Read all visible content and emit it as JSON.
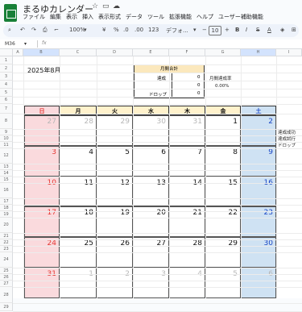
{
  "doc": {
    "title": "まるゆカレンダー"
  },
  "menu": [
    "ファイル",
    "編集",
    "表示",
    "挿入",
    "表示形式",
    "データ",
    "ツール",
    "拡張機能",
    "ヘルプ",
    "ユーザー補助機能"
  ],
  "toolbar": {
    "zoom": "100%",
    "currency": "¥",
    "percent": "%",
    "decimal_dec": ".0",
    "decimal_inc": ".00",
    "format_123": "123",
    "font": "デフォ...",
    "font_size": "10"
  },
  "cell_ref": "M36",
  "columns": [
    "A",
    "B",
    "C",
    "D",
    "E",
    "F",
    "G",
    "H",
    "I"
  ],
  "rows": [
    "1",
    "2",
    "3",
    "4",
    "5",
    "6",
    "7",
    "8",
    "9",
    "10",
    "11",
    "12",
    "13",
    "14",
    "15",
    "16",
    "17",
    "18",
    "19",
    "20",
    "21",
    "22",
    "23",
    "24",
    "25",
    "26",
    "27",
    "28",
    "29"
  ],
  "sheet": {
    "month_title": "2025年8月",
    "summary": {
      "header": "月間合計",
      "row1_label": "達成",
      "row1_value": "0",
      "row2_value": "0",
      "row3_label": "ドロップ",
      "row3_value": "0"
    },
    "rate_label": "月間達成率",
    "rate_value": "0.00%",
    "weekdays": [
      "日",
      "月",
      "火",
      "水",
      "木",
      "金",
      "土"
    ],
    "weeks": [
      [
        "27",
        "28",
        "29",
        "30",
        "31",
        "1",
        "2"
      ],
      [
        "3",
        "4",
        "5",
        "6",
        "7",
        "8",
        "9"
      ],
      [
        "10",
        "11",
        "12",
        "13",
        "14",
        "15",
        "16"
      ],
      [
        "17",
        "18",
        "19",
        "20",
        "21",
        "22",
        "23"
      ],
      [
        "24",
        "25",
        "26",
        "27",
        "28",
        "29",
        "30"
      ],
      [
        "31",
        "1",
        "2",
        "3",
        "4",
        "5",
        "6"
      ]
    ],
    "legend": [
      "達成成功",
      "達成試行",
      "ドロップ"
    ]
  },
  "colors": {
    "sunday_bg": "#fadadd",
    "sunday_text": "#e53935",
    "saturday_bg": "#cfe2f3",
    "saturday_text": "#1a47c6",
    "header_bg": "#fff2cc",
    "muted_text": "#b7b7b7"
  }
}
